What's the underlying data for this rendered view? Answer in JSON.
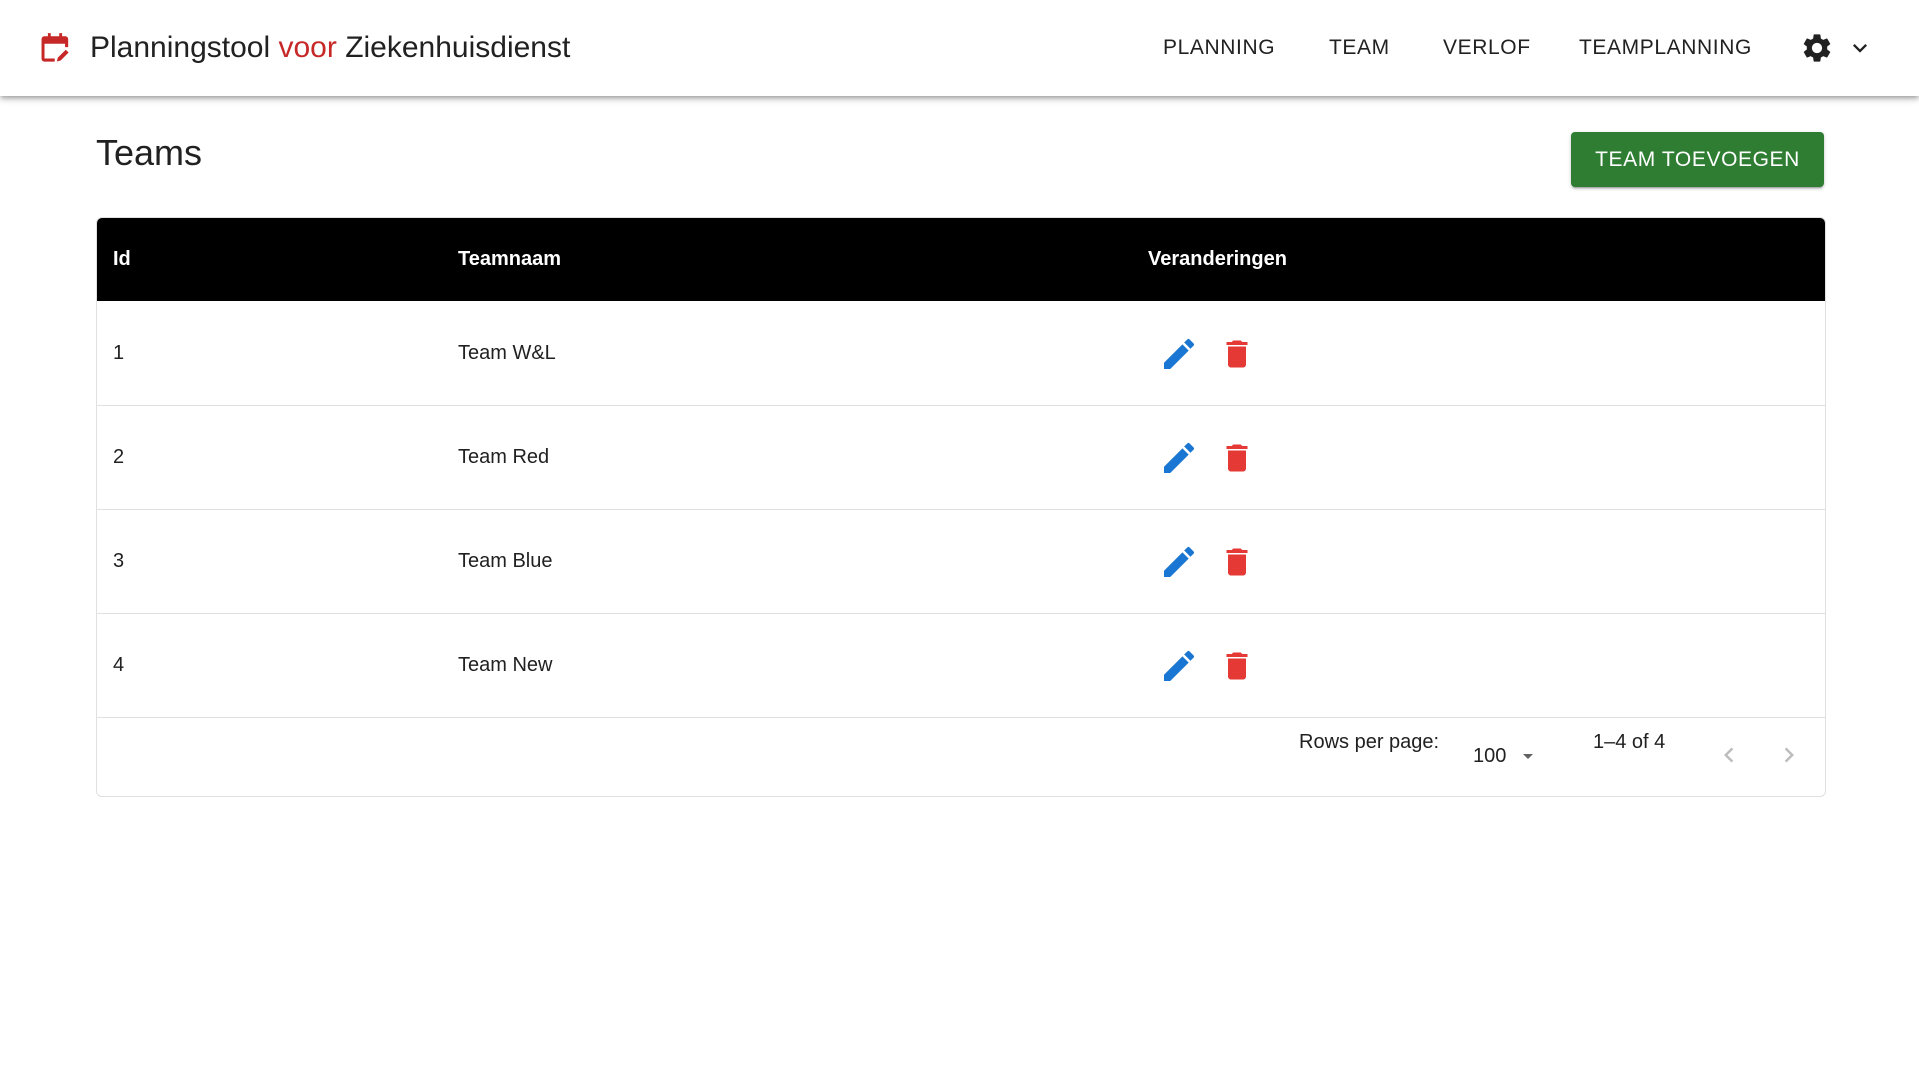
{
  "app": {
    "title_part1": "Planningstool",
    "title_part2": "voor",
    "title_part3": "Ziekenhuisdienst",
    "brand_icon": "calendar-edit-icon"
  },
  "nav": {
    "items": [
      "PLANNING",
      "TEAM",
      "VERLOF",
      "TEAMPLANNING"
    ],
    "settings_icon": "gear-icon",
    "menu_icon": "chevron-down-icon"
  },
  "page": {
    "title": "Teams",
    "add_button": "TEAM TOEVOEGEN"
  },
  "table": {
    "headers": [
      "Id",
      "Teamnaam",
      "Veranderingen"
    ],
    "rows": [
      {
        "id": "1",
        "name": "Team W&L"
      },
      {
        "id": "2",
        "name": "Team Red"
      },
      {
        "id": "3",
        "name": "Team Blue"
      },
      {
        "id": "4",
        "name": "Team New"
      }
    ],
    "action_icons": [
      "pencil-icon",
      "trash-icon"
    ]
  },
  "pagination": {
    "rows_per_page_label": "Rows per page:",
    "rows_per_page_value": "100",
    "range_text": "1–4 of 4"
  },
  "colors": {
    "accent_red": "#c62828",
    "primary_green": "#2e7d32",
    "edit_blue": "#1976d2",
    "delete_red": "#e53935",
    "header_black": "#000000"
  }
}
